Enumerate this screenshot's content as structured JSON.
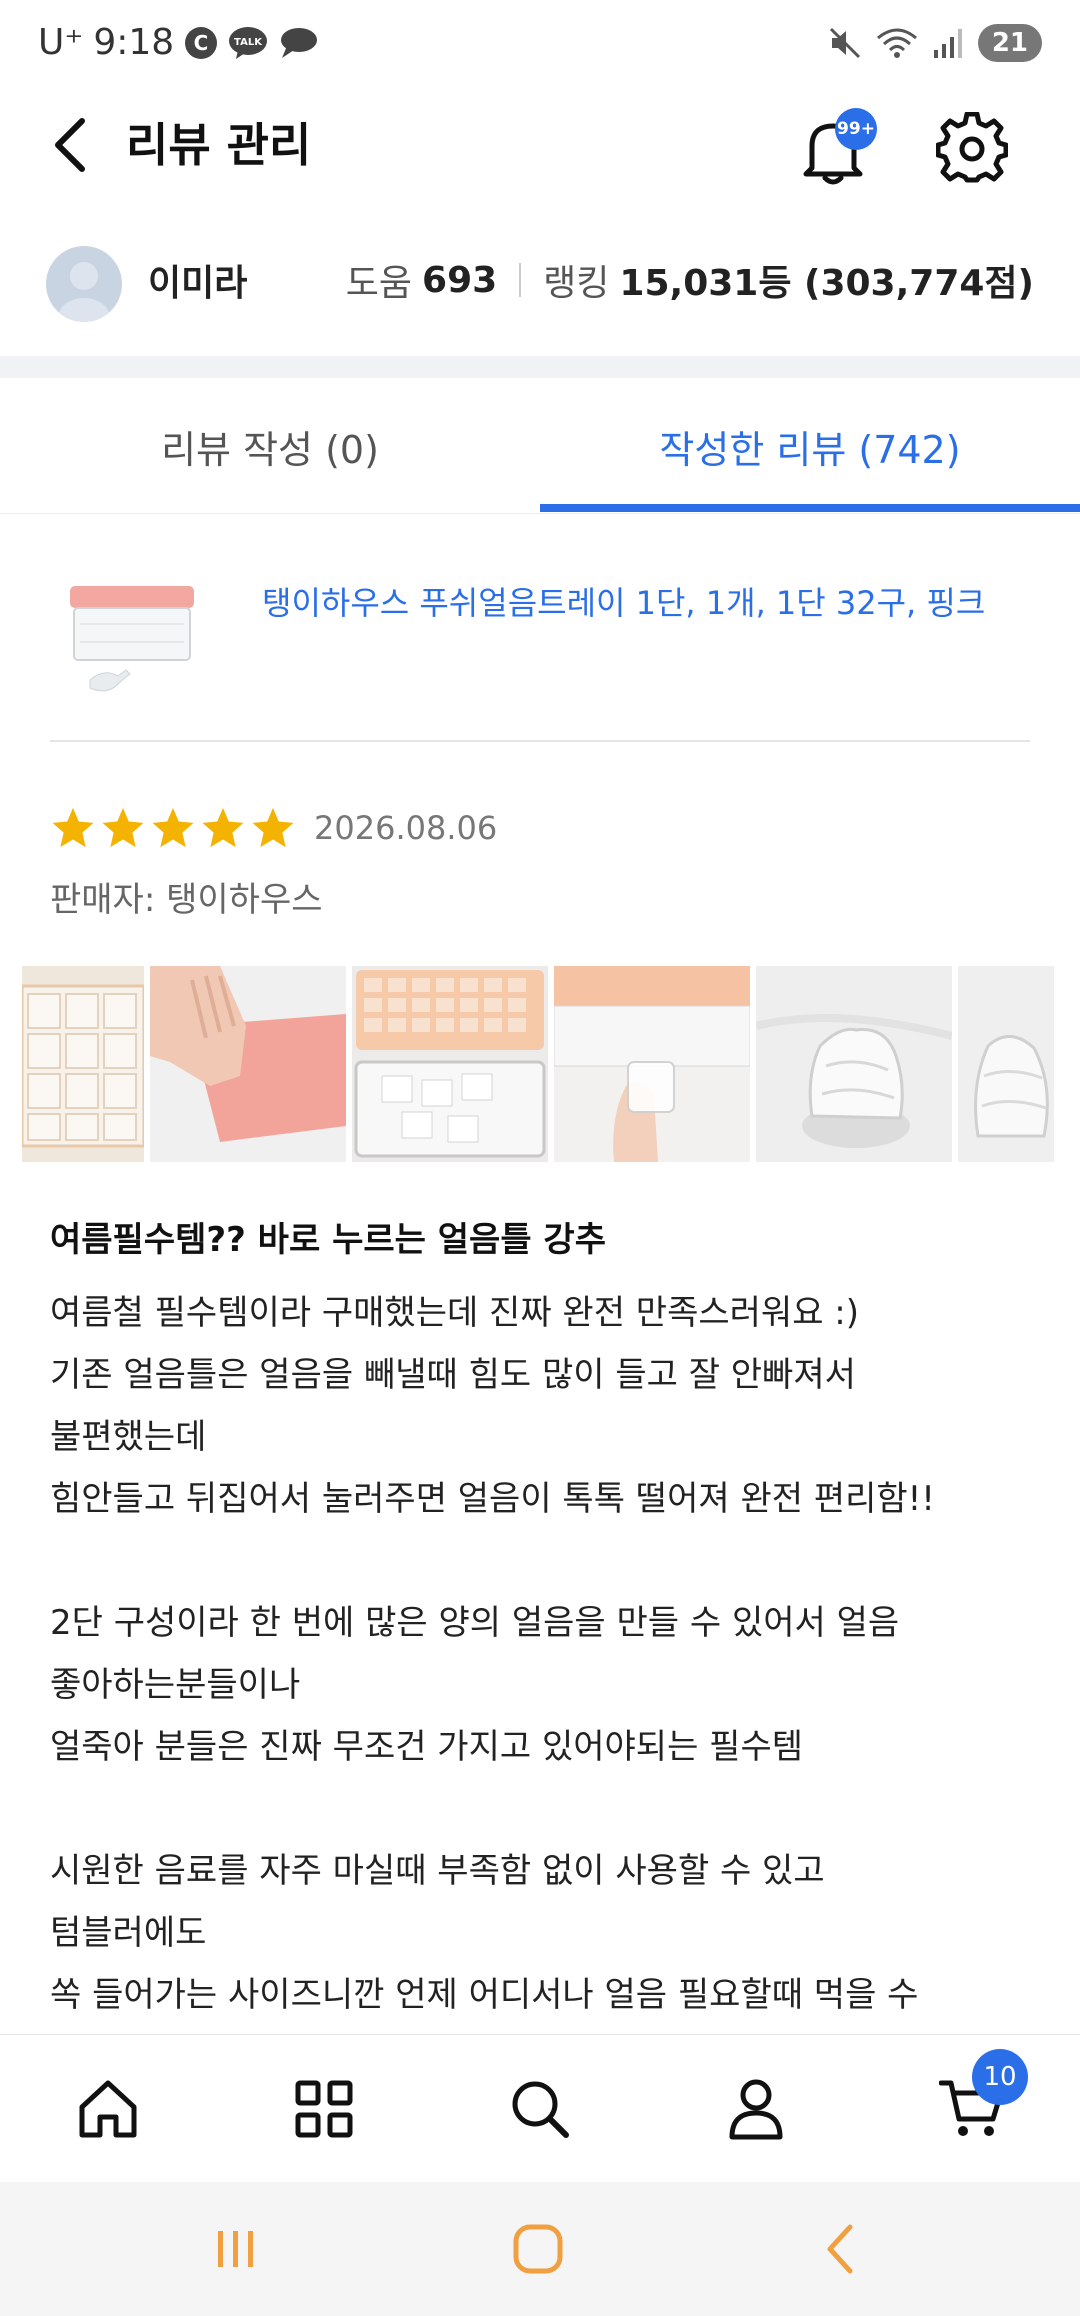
{
  "status_bar": {
    "carrier": "U⁺",
    "time": "9:18",
    "battery": "21"
  },
  "app_bar": {
    "title": "리뷰 관리",
    "notification_badge": "99+"
  },
  "profile": {
    "name": "이미라",
    "help_label": "도움",
    "help_value": "693",
    "ranking_label": "랭킹",
    "ranking_value": "15,031등 (303,774점)"
  },
  "tabs": [
    {
      "label": "리뷰 작성 (0)",
      "active": false
    },
    {
      "label": "작성한 리뷰 (742)",
      "active": true
    }
  ],
  "product": {
    "name": "탱이하우스 푸쉬얼음트레이 1단, 1개, 1단 32구, 핑크"
  },
  "review": {
    "rating": 5,
    "date": "2026.08.06",
    "seller": "판매자: 탱이하우스",
    "title": "여름필수템?? 바로 누르는 얼음틀 강추",
    "lines": [
      "여름철 필수템이라 구매했는데 진짜 완전 만족스러워요 :)",
      "기존 얼음틀은 얼음을 빼낼때 힘도 많이 들고 잘 안빠져서",
      "불편했는데",
      "힘안들고 뒤집어서 눌러주면 얼음이 톡톡 떨어져 완전 편리함!!",
      "",
      "2단 구성이라 한 번에 많은 양의 얼음을 만들 수 있어서 얼음",
      "좋아하는분들이나",
      "얼죽아 분들은 진짜 무조건 가지고 있어야되는 필수템",
      "",
      "시원한 음료를 자주 마실때 부족함 없이 사용할 수 있고",
      "텀블러에도",
      "쏙 들어가는 사이즈니깐 언제 어디서나 얼음 필요할때 먹을 수"
    ]
  },
  "bottom_nav": {
    "cart_badge": "10"
  },
  "colors": {
    "accent": "#2a6ee8",
    "star": "#f5b301"
  }
}
